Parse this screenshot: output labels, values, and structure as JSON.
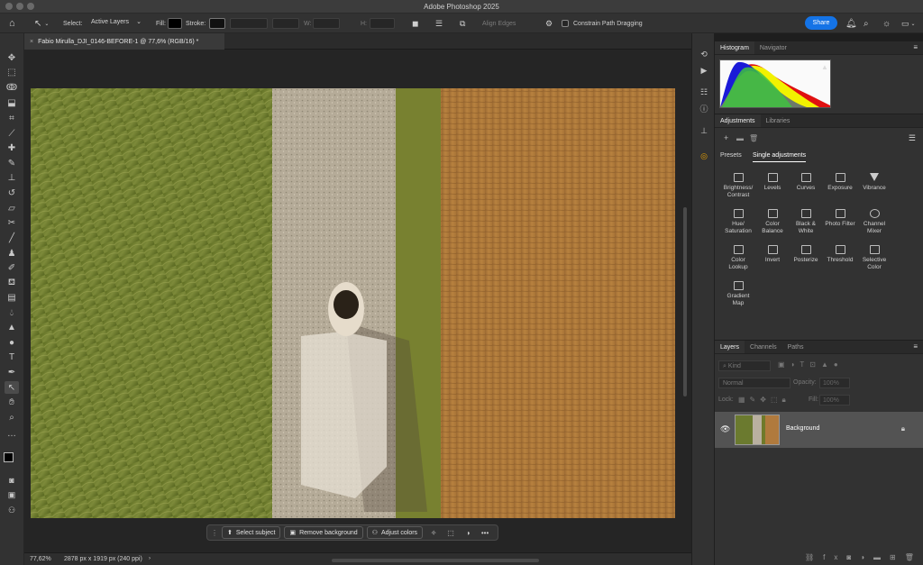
{
  "app_title": "Adobe Photoshop 2025",
  "options_bar": {
    "select_label": "Select:",
    "select_value": "Active Layers",
    "fill_label": "Fill:",
    "stroke_label": "Stroke:",
    "w_label": "W:",
    "h_label": "H:",
    "align_edges": "Align Edges",
    "constrain_path": "Constrain Path Dragging",
    "share": "Share"
  },
  "document_tab": {
    "title": "Fabio Mirulla_DJI_0146-BEFORE-1 @ 77,6% (RGB/16) *",
    "close": "×"
  },
  "contextual_bar": {
    "select_subject": "Select subject",
    "remove_background": "Remove background",
    "adjust_colors": "Adjust colors",
    "more": "•••"
  },
  "status_bar": {
    "zoom": "77,62%",
    "doc_info": "2878 px x 1919 px (240 ppi)"
  },
  "histogram_panel": {
    "tabs": [
      "Histogram",
      "Navigator"
    ],
    "warning": "▲"
  },
  "adjustments_panel": {
    "tabs": [
      "Adjustments",
      "Libraries"
    ],
    "subtabs": [
      "Presets",
      "Single adjustments"
    ],
    "items": [
      "Brightness/\nContrast",
      "Levels",
      "Curves",
      "Exposure",
      "Vibrance",
      "Hue/\nSaturation",
      "Color\nBalance",
      "Black &\nWhite",
      "Photo Filter",
      "Channel\nMixer",
      "Color\nLookup",
      "Invert",
      "Posterize",
      "Threshold",
      "Selective\nColor",
      "Gradient\nMap"
    ]
  },
  "layers_panel": {
    "tabs": [
      "Layers",
      "Channels",
      "Paths"
    ],
    "kind_label": "Kind",
    "blend_mode": "Normal",
    "opacity_label": "Opacity:",
    "opacity_value": "100%",
    "lock_label": "Lock:",
    "fill_label": "Fill:",
    "fill_value": "100%",
    "layer_name": "Background"
  },
  "colors": {
    "accent": "#1473e6",
    "grass": "#6b7a2f",
    "dirt": "#b07a3d",
    "gravel": "#b9b0a0"
  }
}
